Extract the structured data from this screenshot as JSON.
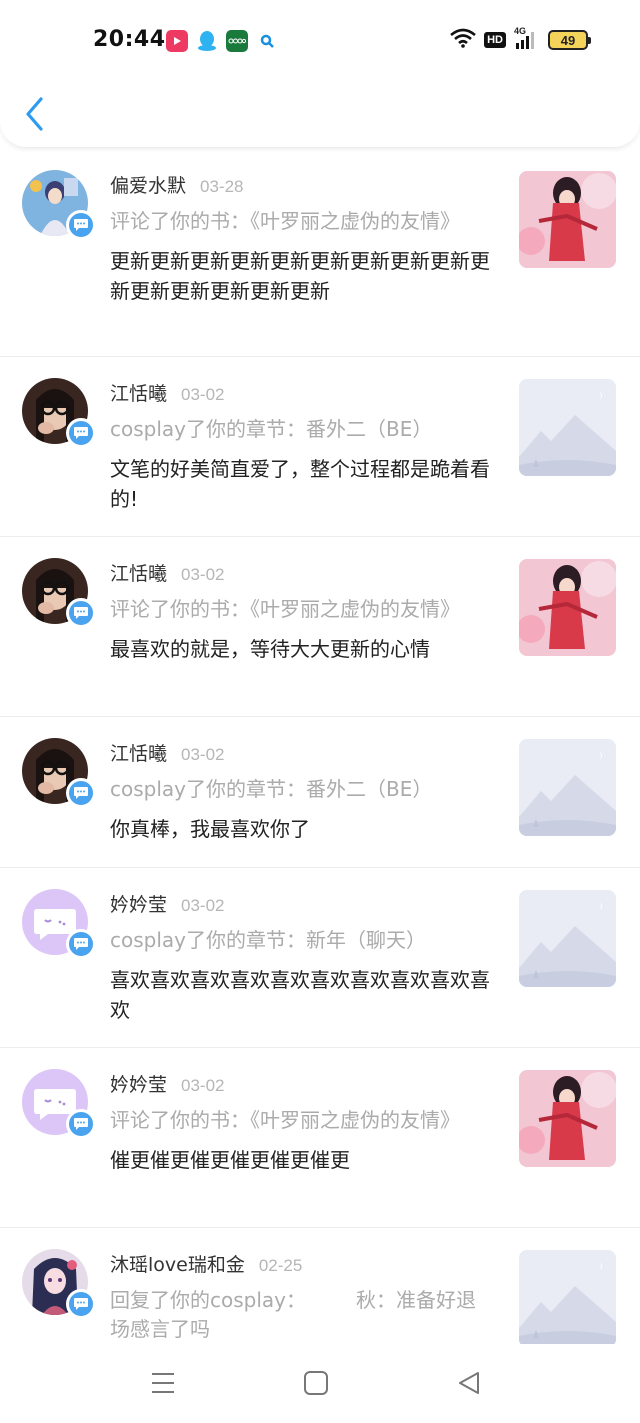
{
  "status_bar": {
    "time": "20:44",
    "hd_label": "HD",
    "network_label": "4G",
    "battery_level": "49",
    "app_icons": [
      "video-app-icon",
      "qq-icon",
      "oppo-icon",
      "search-app-icon"
    ]
  },
  "header": {
    "back_icon": "chevron-left-icon"
  },
  "notifications": [
    {
      "name": "偏爱水默",
      "date": "03-28",
      "action": "评论了你的书：《叶罗丽之虚伪的友情》",
      "comment": "更新更新更新更新更新更新更新更新更新更新更新更新更新更新更新",
      "thumbnail": "cover-art",
      "avatar": "avatar-girl-anime"
    },
    {
      "name": "江恬曦",
      "date": "03-02",
      "action": "cosplay了你的章节：番外二（BE）",
      "comment": "文笔的好美简直爱了，整个过程都是跪着看的!",
      "thumbnail": "placeholder",
      "avatar": "avatar-photo"
    },
    {
      "name": "江恬曦",
      "date": "03-02",
      "action": "评论了你的书：《叶罗丽之虚伪的友情》",
      "comment": "最喜欢的就是，等待大大更新的心情",
      "thumbnail": "cover-art",
      "avatar": "avatar-photo"
    },
    {
      "name": "江恬曦",
      "date": "03-02",
      "action": "cosplay了你的章节：番外二（BE）",
      "comment": "你真棒，我最喜欢你了",
      "thumbnail": "placeholder",
      "avatar": "avatar-photo"
    },
    {
      "name": "妗妗莹",
      "date": "03-02",
      "action": "cosplay了你的章节：新年（聊天）",
      "comment": "喜欢喜欢喜欢喜欢喜欢喜欢喜欢喜欢喜欢喜欢",
      "thumbnail": "placeholder",
      "avatar": "avatar-default"
    },
    {
      "name": "妗妗莹",
      "date": "03-02",
      "action": "评论了你的书：《叶罗丽之虚伪的友情》",
      "comment": "催更催更催更催更催更催更",
      "thumbnail": "cover-art",
      "avatar": "avatar-default"
    },
    {
      "name": "沐瑶love瑞和金",
      "date": "02-25",
      "action": "回复了你的cosplay：　　　秋：准备好退场感言了吗",
      "comment": "",
      "thumbnail": "placeholder",
      "avatar": "avatar-girl-anime-2"
    }
  ],
  "nav_bar": {
    "menu_icon": "menu-icon",
    "home_icon": "home-square-icon",
    "back_icon": "back-triangle-icon"
  },
  "colors": {
    "accent": "#4aa3ee",
    "back_arrow": "#2d9bef",
    "muted_text": "#ababab",
    "date_text": "#b6b6b6",
    "default_avatar_bg": "#dcc6f7"
  }
}
